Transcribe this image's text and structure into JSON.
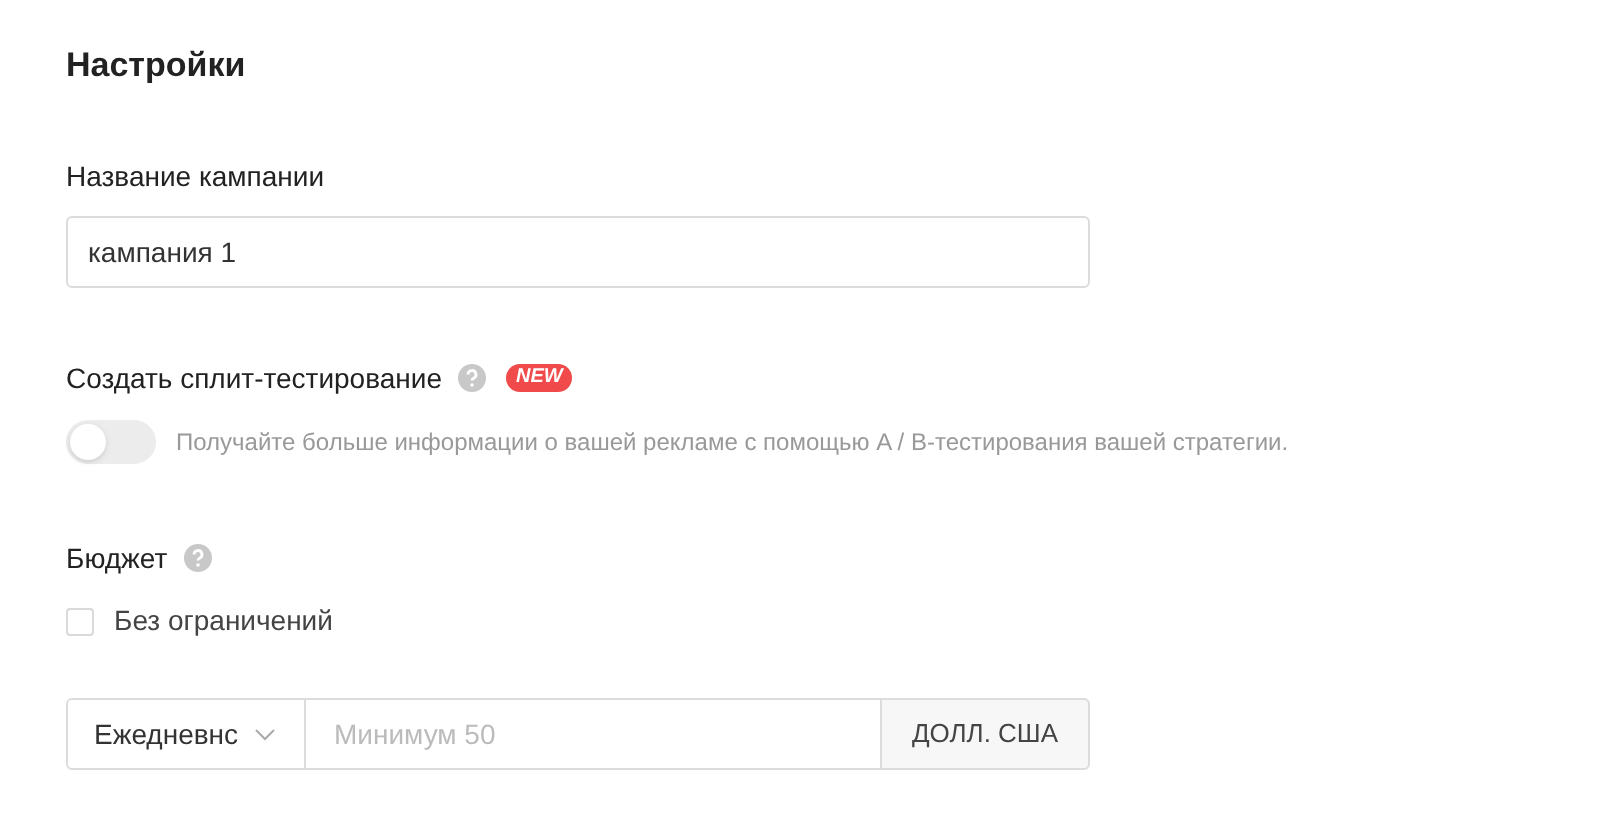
{
  "title": "Настройки",
  "campaign_name": {
    "label": "Название кампании",
    "value": "кампания 1"
  },
  "split_test": {
    "label": "Создать сплит-тестирование",
    "badge": "NEW",
    "on": false,
    "description": "Получайте больше информации о вашей рекламе с помощью A / B-тестирования вашей стратегии."
  },
  "budget": {
    "label": "Бюджет",
    "unlimited": {
      "label": "Без ограничений",
      "checked": false
    },
    "period": "Ежедневнс",
    "amount": {
      "placeholder": "Минимум 50"
    },
    "currency": "ДОЛЛ. США"
  }
}
